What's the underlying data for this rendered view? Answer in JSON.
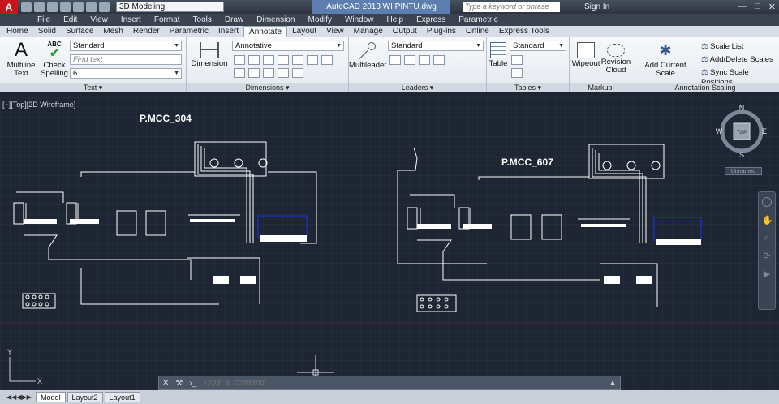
{
  "titlebar": {
    "logo": "A",
    "workspace": "3D Modeling",
    "app_title": "AutoCAD 2013    WI PINTU.dwg",
    "search_placeholder": "Type a keyword or phrase",
    "signin": "Sign In",
    "win_min": "—",
    "win_max": "□",
    "win_close": "✕"
  },
  "menubar": [
    "File",
    "Edit",
    "View",
    "Insert",
    "Format",
    "Tools",
    "Draw",
    "Dimension",
    "Modify",
    "Window",
    "Help",
    "Express",
    "Parametric"
  ],
  "ribbon_tabs": [
    "Home",
    "Solid",
    "Surface",
    "Mesh",
    "Render",
    "Parametric",
    "Insert",
    "Annotate",
    "Layout",
    "View",
    "Manage",
    "Output",
    "Plug-ins",
    "Online",
    "Express Tools"
  ],
  "active_tab": "Annotate",
  "panels": {
    "text": {
      "title": "Text",
      "multiline_label": "Multiline Text",
      "check_spelling_label": "Check Spelling",
      "style_value": "Standard",
      "find_placeholder": "Find text",
      "height_value": "6"
    },
    "dimensions": {
      "title": "Dimensions",
      "dimension_label": "Dimension",
      "style_value": "Annotative"
    },
    "leaders": {
      "title": "Leaders",
      "multileader_label": "Multileader",
      "style_value": "Standard"
    },
    "tables": {
      "title": "Tables",
      "table_label": "Table",
      "style_value": "Standard"
    },
    "markup": {
      "title": "Markup",
      "wipeout_label": "Wipeout",
      "revision_label": "Revision Cloud"
    },
    "annotation_scaling": {
      "title": "Annotation Scaling",
      "add_current_label": "Add Current Scale",
      "scale_list": "Scale List",
      "add_delete": "Add/Delete Scales",
      "sync": "Sync Scale Positions"
    }
  },
  "viewport": {
    "label": "[−][Top][2D Wireframe]",
    "drawing_title_1": "P.MCC_304",
    "drawing_title_2": "P.MCC_607",
    "viewcube": {
      "n": "N",
      "s": "S",
      "e": "E",
      "w": "W",
      "top": "TOP"
    },
    "ucs_name": "Unnamed",
    "ucs_x": "X",
    "ucs_y": "Y"
  },
  "command_line": {
    "placeholder": "Type a command"
  },
  "layout_tabs": [
    "Model",
    "Layout2",
    "Layout1"
  ],
  "colors": {
    "canvas": "#1f2633",
    "wire": "#ffffff",
    "blue_block": "#1e2fd6",
    "red_axis": "#6e2028"
  }
}
